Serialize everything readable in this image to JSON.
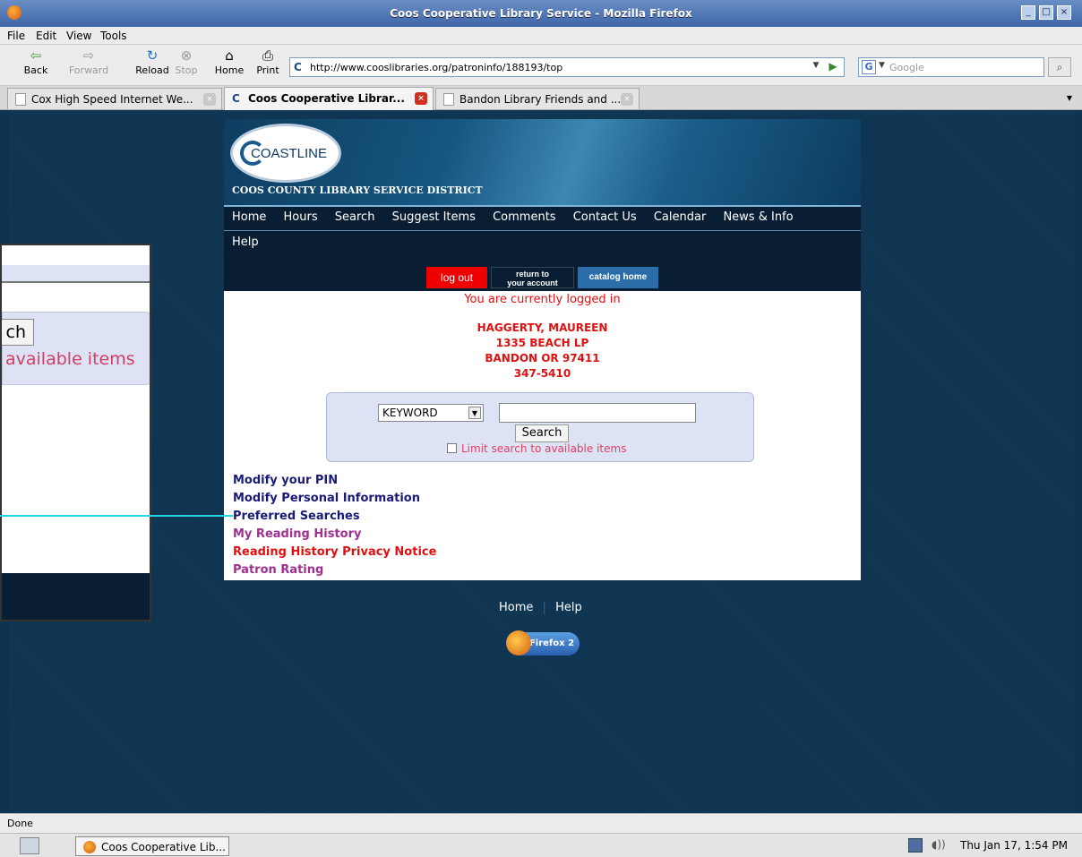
{
  "window": {
    "title": "Coos Cooperative Library Service - Mozilla Firefox",
    "controls": [
      "_",
      "□",
      "×"
    ]
  },
  "menu": [
    "File",
    "Edit",
    "View",
    "Tools"
  ],
  "nav": {
    "back": "Back",
    "forward": "Forward",
    "reload": "Reload",
    "stop": "Stop",
    "home": "Home",
    "print": "Print",
    "url": "http://www.cooslibraries.org/patroninfo/188193/top",
    "search_placeholder": "Google"
  },
  "tabs": [
    {
      "label": "Cox High Speed Internet We...",
      "active": false
    },
    {
      "label": "Coos Cooperative Librar...",
      "active": true
    },
    {
      "label": "Bandon Library Friends and ...",
      "active": false
    }
  ],
  "site": {
    "logo": "COASTLINE",
    "district": "COOS COUNTY LIBRARY SERVICE DISTRICT",
    "nav": [
      "Home",
      "Hours",
      "Search",
      "Suggest Items",
      "Comments",
      "Contact Us",
      "Calendar",
      "News & Info"
    ],
    "nav2": "Help",
    "buttons": {
      "logout": "log out",
      "return_line1": "return to",
      "return_line2": "your account",
      "catalog": "catalog home"
    },
    "logged_in": "You are currently logged in",
    "patron": {
      "name": "HAGGERTY, MAUREEN",
      "address": "1335 BEACH LP",
      "city": "BANDON OR 97411",
      "phone": "347-5410"
    },
    "search": {
      "index": "KEYWORD",
      "input_value": "",
      "button": "Search",
      "limit": "Limit search to available items"
    },
    "links": [
      {
        "label": "Modify your PIN",
        "color": "#1a1a7a"
      },
      {
        "label": "Modify Personal Information",
        "color": "#1a1a7a"
      },
      {
        "label": "Preferred Searches",
        "color": "#1a1a7a"
      },
      {
        "label": "My Reading History",
        "color": "#a03090"
      },
      {
        "label": "Reading History Privacy Notice",
        "color": "#e01010"
      },
      {
        "label": "Patron Rating",
        "color": "#a03090"
      }
    ],
    "footer": [
      "Home",
      "Help"
    ],
    "badge": "Firefox 2"
  },
  "zoom": {
    "button_text": "ch",
    "limit_text": "available items"
  },
  "status": "Done",
  "taskbar": {
    "window": "Coos Cooperative Lib...",
    "clock": "Thu Jan 17,  1:54 PM"
  },
  "colors": {
    "page_bg": "#0d3350",
    "logout": "#ee0000",
    "return": "#0a1e33",
    "catalog": "#2b6da8",
    "patron_text": "#e01010"
  }
}
